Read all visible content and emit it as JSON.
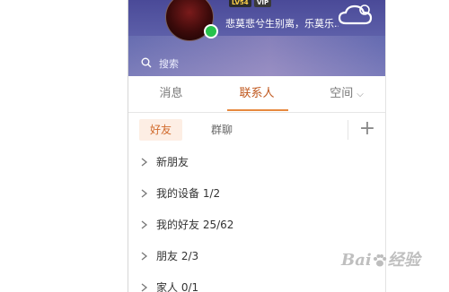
{
  "header": {
    "level_badge": "LV54",
    "vip_badge": "VIP",
    "signature": "悲莫悲兮生别离，乐莫乐...",
    "search_placeholder": "搜索"
  },
  "tabs": [
    {
      "label": "消息",
      "active": false
    },
    {
      "label": "联系人",
      "active": true
    },
    {
      "label": "空间",
      "active": false
    }
  ],
  "subtabs": [
    {
      "label": "好友",
      "active": true
    },
    {
      "label": "群聊",
      "active": false
    }
  ],
  "add_label": "+",
  "groups": [
    {
      "label": "新朋友"
    },
    {
      "label": "我的设备 1/2"
    },
    {
      "label": "我的好友 25/62"
    },
    {
      "label": "朋友 2/3"
    },
    {
      "label": "家人 0/1"
    }
  ],
  "watermark": {
    "text_left": "Bai",
    "text_right": "经验"
  },
  "colors": {
    "accent": "#e7893f",
    "active_tab_text": "#c0581e",
    "header_bg": "#5c5ea8",
    "online": "#27c24c"
  }
}
